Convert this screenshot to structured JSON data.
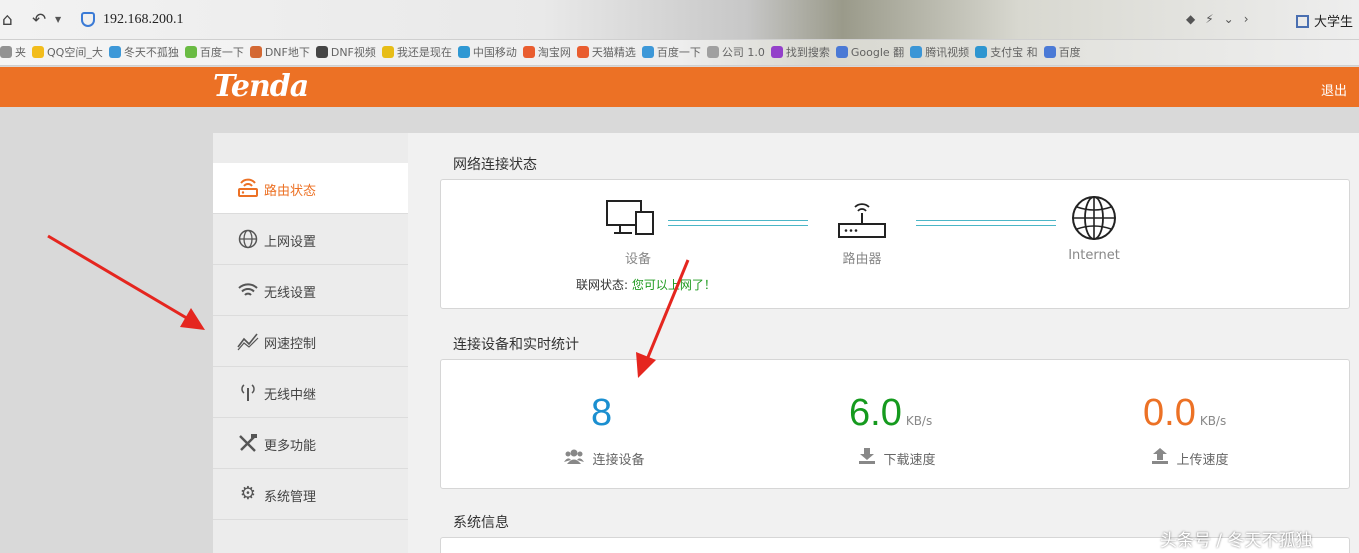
{
  "browser": {
    "url": "192.168.200.1",
    "site_tab": "大学生",
    "bookmarks": [
      {
        "label": "夹",
        "color": "#888888"
      },
      {
        "label": "QQ空间_大",
        "color": "#f2b705"
      },
      {
        "label": "冬天不孤独",
        "color": "#2a8fd6"
      },
      {
        "label": "百度一下",
        "color": "#5cb531"
      },
      {
        "label": "DNF地下",
        "color": "#d05a1f"
      },
      {
        "label": "DNF视频",
        "color": "#333333"
      },
      {
        "label": "我还是现在",
        "color": "#e6b800"
      },
      {
        "label": "中国移动",
        "color": "#1b8fd0"
      },
      {
        "label": "淘宝网",
        "color": "#e94e1b"
      },
      {
        "label": "天猫精选",
        "color": "#e94e1b"
      },
      {
        "label": "百度一下",
        "color": "#2a8fd6"
      },
      {
        "label": "公司 1.0",
        "color": "#999999"
      },
      {
        "label": "找到搜索",
        "color": "#8b2fc9"
      },
      {
        "label": "Google 翻",
        "color": "#3b6fd6"
      },
      {
        "label": "腾讯视频",
        "color": "#2a8fd6"
      },
      {
        "label": "支付宝 和",
        "color": "#1b8fd0"
      },
      {
        "label": "百度",
        "color": "#3b6fd6"
      }
    ]
  },
  "header": {
    "logo": "Tenda",
    "logout": "退出",
    "accent": "#ec7125"
  },
  "sidebar": {
    "items": [
      {
        "label": "路由状态",
        "icon": "router-icon"
      },
      {
        "label": "上网设置",
        "icon": "globe-icon"
      },
      {
        "label": "无线设置",
        "icon": "wifi-icon"
      },
      {
        "label": "网速控制",
        "icon": "speed-icon"
      },
      {
        "label": "无线中继",
        "icon": "antenna-icon"
      },
      {
        "label": "更多功能",
        "icon": "tools-icon"
      },
      {
        "label": "系统管理",
        "icon": "gear-icon"
      }
    ]
  },
  "network_status": {
    "title": "网络连接状态",
    "device_label": "设备",
    "router_label": "路由器",
    "internet_label": "Internet",
    "status_prefix": "联网状态:",
    "status_text": "您可以上网了！"
  },
  "statistics": {
    "title": "连接设备和实时统计",
    "devices": {
      "value": "8",
      "label": "连接设备",
      "color": "#1b8fd0"
    },
    "download": {
      "value": "6.0",
      "unit": "KB/s",
      "label": "下载速度",
      "color": "#159a1e"
    },
    "upload": {
      "value": "0.0",
      "unit": "KB/s",
      "label": "上传速度",
      "color": "#ec7125"
    }
  },
  "system_info": {
    "title": "系统信息"
  },
  "watermark": "头条号 / 冬天不孤独"
}
